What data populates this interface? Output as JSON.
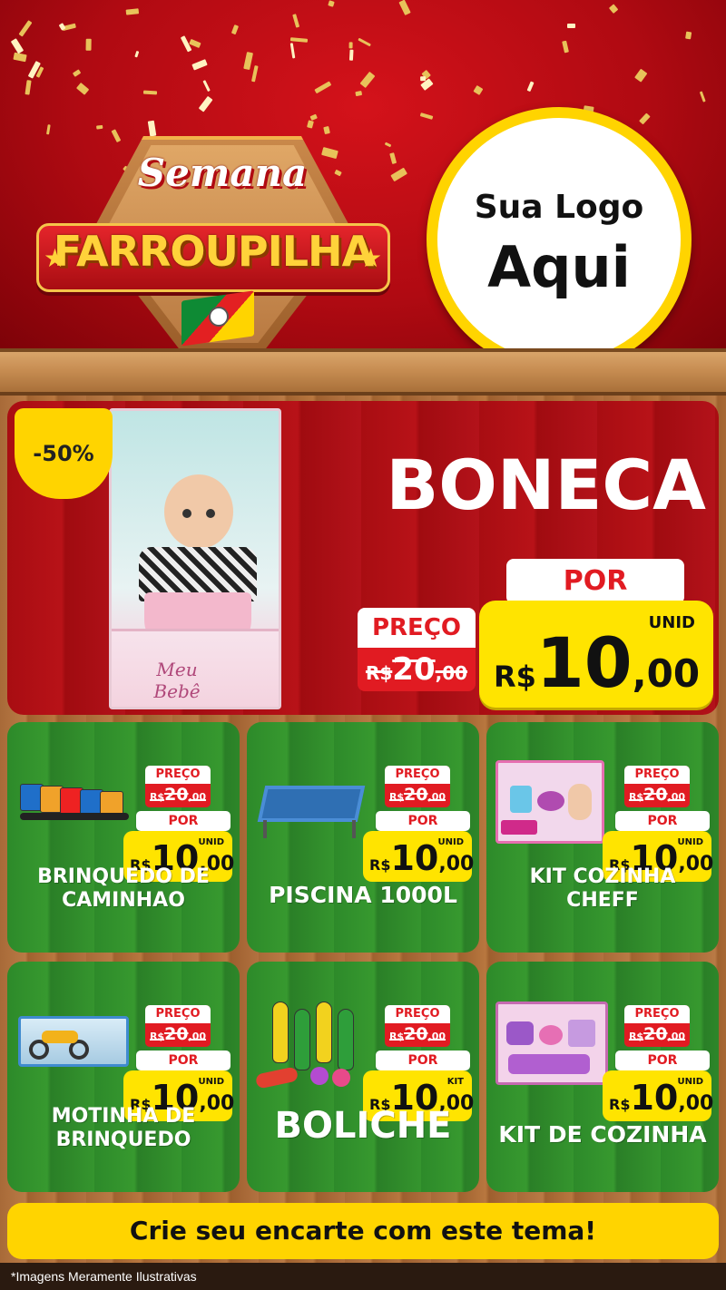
{
  "header": {
    "title_small": "Semana",
    "title_big": "FARROUPILHA",
    "logo_line1": "Sua Logo",
    "logo_line2": "Aqui"
  },
  "hero": {
    "discount": "-50%",
    "product_box_text": "Meu Bebê",
    "name": "BONECA",
    "preco_label": "PREÇO",
    "old_price_currency": "R$",
    "old_price_int": "20",
    "old_price_dec": ",00",
    "por_label": "POR",
    "unit": "UNID",
    "currency": "R$",
    "price_int": "10",
    "price_dec": ",00"
  },
  "cards": [
    {
      "name_lines": [
        "BRINQUEDO DE",
        "CAMINHAO"
      ],
      "preco_label": "PREÇO",
      "old_price_currency": "R$",
      "old_price_int": "20",
      "old_price_dec": ",00",
      "por_label": "POR",
      "unit": "UNID",
      "currency": "R$",
      "price_int": "10",
      "price_dec": ",00",
      "image_icon": "toy-trucks-icon"
    },
    {
      "name_lines": [
        "PISCINA 1000L"
      ],
      "preco_label": "PREÇO",
      "old_price_currency": "R$",
      "old_price_int": "20",
      "old_price_dec": ",00",
      "por_label": "POR",
      "unit": "UNID",
      "currency": "R$",
      "price_int": "10",
      "price_dec": ",00",
      "image_icon": "pool-icon"
    },
    {
      "name_lines": [
        "KIT COZINHA",
        "CHEFF"
      ],
      "preco_label": "PREÇO",
      "old_price_currency": "R$",
      "old_price_int": "20",
      "old_price_dec": ",00",
      "por_label": "POR",
      "unit": "UNID",
      "currency": "R$",
      "price_int": "10",
      "price_dec": ",00",
      "image_icon": "kitchen-kit-icon"
    },
    {
      "name_lines": [
        "MOTINHA DE",
        "BRINQUEDO"
      ],
      "preco_label": "PREÇO",
      "old_price_currency": "R$",
      "old_price_int": "20",
      "old_price_dec": ",00",
      "por_label": "POR",
      "unit": "UNID",
      "currency": "R$",
      "price_int": "10",
      "price_dec": ",00",
      "image_icon": "toy-motorcycle-icon"
    },
    {
      "name_lines": [
        "BOLICHE"
      ],
      "preco_label": "PREÇO",
      "old_price_currency": "R$",
      "old_price_int": "20",
      "old_price_dec": ",00",
      "por_label": "POR",
      "unit": "KIT",
      "currency": "R$",
      "price_int": "10",
      "price_dec": ",00",
      "image_icon": "bowling-pins-icon"
    },
    {
      "name_lines": [
        "KIT DE COZINHA"
      ],
      "preco_label": "PREÇO",
      "old_price_currency": "R$",
      "old_price_int": "20",
      "old_price_dec": ",00",
      "por_label": "POR",
      "unit": "UNID",
      "currency": "R$",
      "price_int": "10",
      "price_dec": ",00",
      "image_icon": "kitchen-set-icon"
    }
  ],
  "footer": {
    "cta": "Crie seu encarte com este tema!",
    "disclaimer": "*Imagens Meramente Ilustrativas"
  },
  "colors": {
    "header_red": "#c40f17",
    "card_green": "#2f8c2b",
    "price_yellow": "#ffe400",
    "label_red": "#e11b22",
    "title_gold": "#ffd23a"
  }
}
